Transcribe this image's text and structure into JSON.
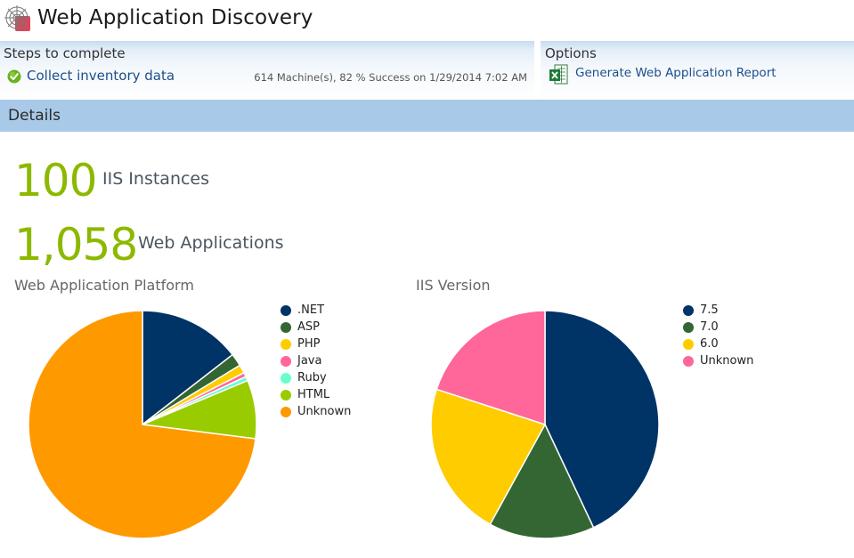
{
  "app": {
    "title": "Web Application Discovery"
  },
  "steps": {
    "heading": "Steps to complete",
    "collect_label": "Collect inventory data",
    "status": "614 Machine(s), 82 % Success on 1/29/2014 7:02 AM"
  },
  "options": {
    "heading": "Options",
    "report_label": "Generate Web Application Report"
  },
  "details": {
    "heading": "Details"
  },
  "kpis": {
    "iis": {
      "value": "100",
      "label": "IIS Instances"
    },
    "webapps": {
      "value": "1,058",
      "label": "Web Applications"
    }
  },
  "colors": {
    "kpi_green": "#8cb900",
    "link_blue": "#1b4f8a",
    "details_bar": "#a9c9e9"
  },
  "icons": {
    "app": "spider-web-icon",
    "check": "check-circle-icon",
    "excel": "excel-icon"
  },
  "chart_data": [
    {
      "type": "pie",
      "title": "Web Application Platform",
      "legend_position": "right",
      "slices": [
        {
          "label": ".NET",
          "value": 14.5,
          "color": "#003366"
        },
        {
          "label": "ASP",
          "value": 1.8,
          "color": "#336633"
        },
        {
          "label": "PHP",
          "value": 1.2,
          "color": "#ffcc00"
        },
        {
          "label": "Java",
          "value": 0.6,
          "color": "#ff6699"
        },
        {
          "label": "Ruby",
          "value": 0.6,
          "color": "#66ffcc"
        },
        {
          "label": "HTML",
          "value": 8.3,
          "color": "#99cc00"
        },
        {
          "label": "Unknown",
          "value": 73.0,
          "color": "#ff9900"
        }
      ]
    },
    {
      "type": "pie",
      "title": "IIS Version",
      "legend_position": "right",
      "slices": [
        {
          "label": "7.5",
          "value": 43,
          "color": "#003366"
        },
        {
          "label": "7.0",
          "value": 15,
          "color": "#336633"
        },
        {
          "label": "6.0",
          "value": 22,
          "color": "#ffcc00"
        },
        {
          "label": "Unknown",
          "value": 20,
          "color": "#ff6699"
        }
      ]
    }
  ]
}
